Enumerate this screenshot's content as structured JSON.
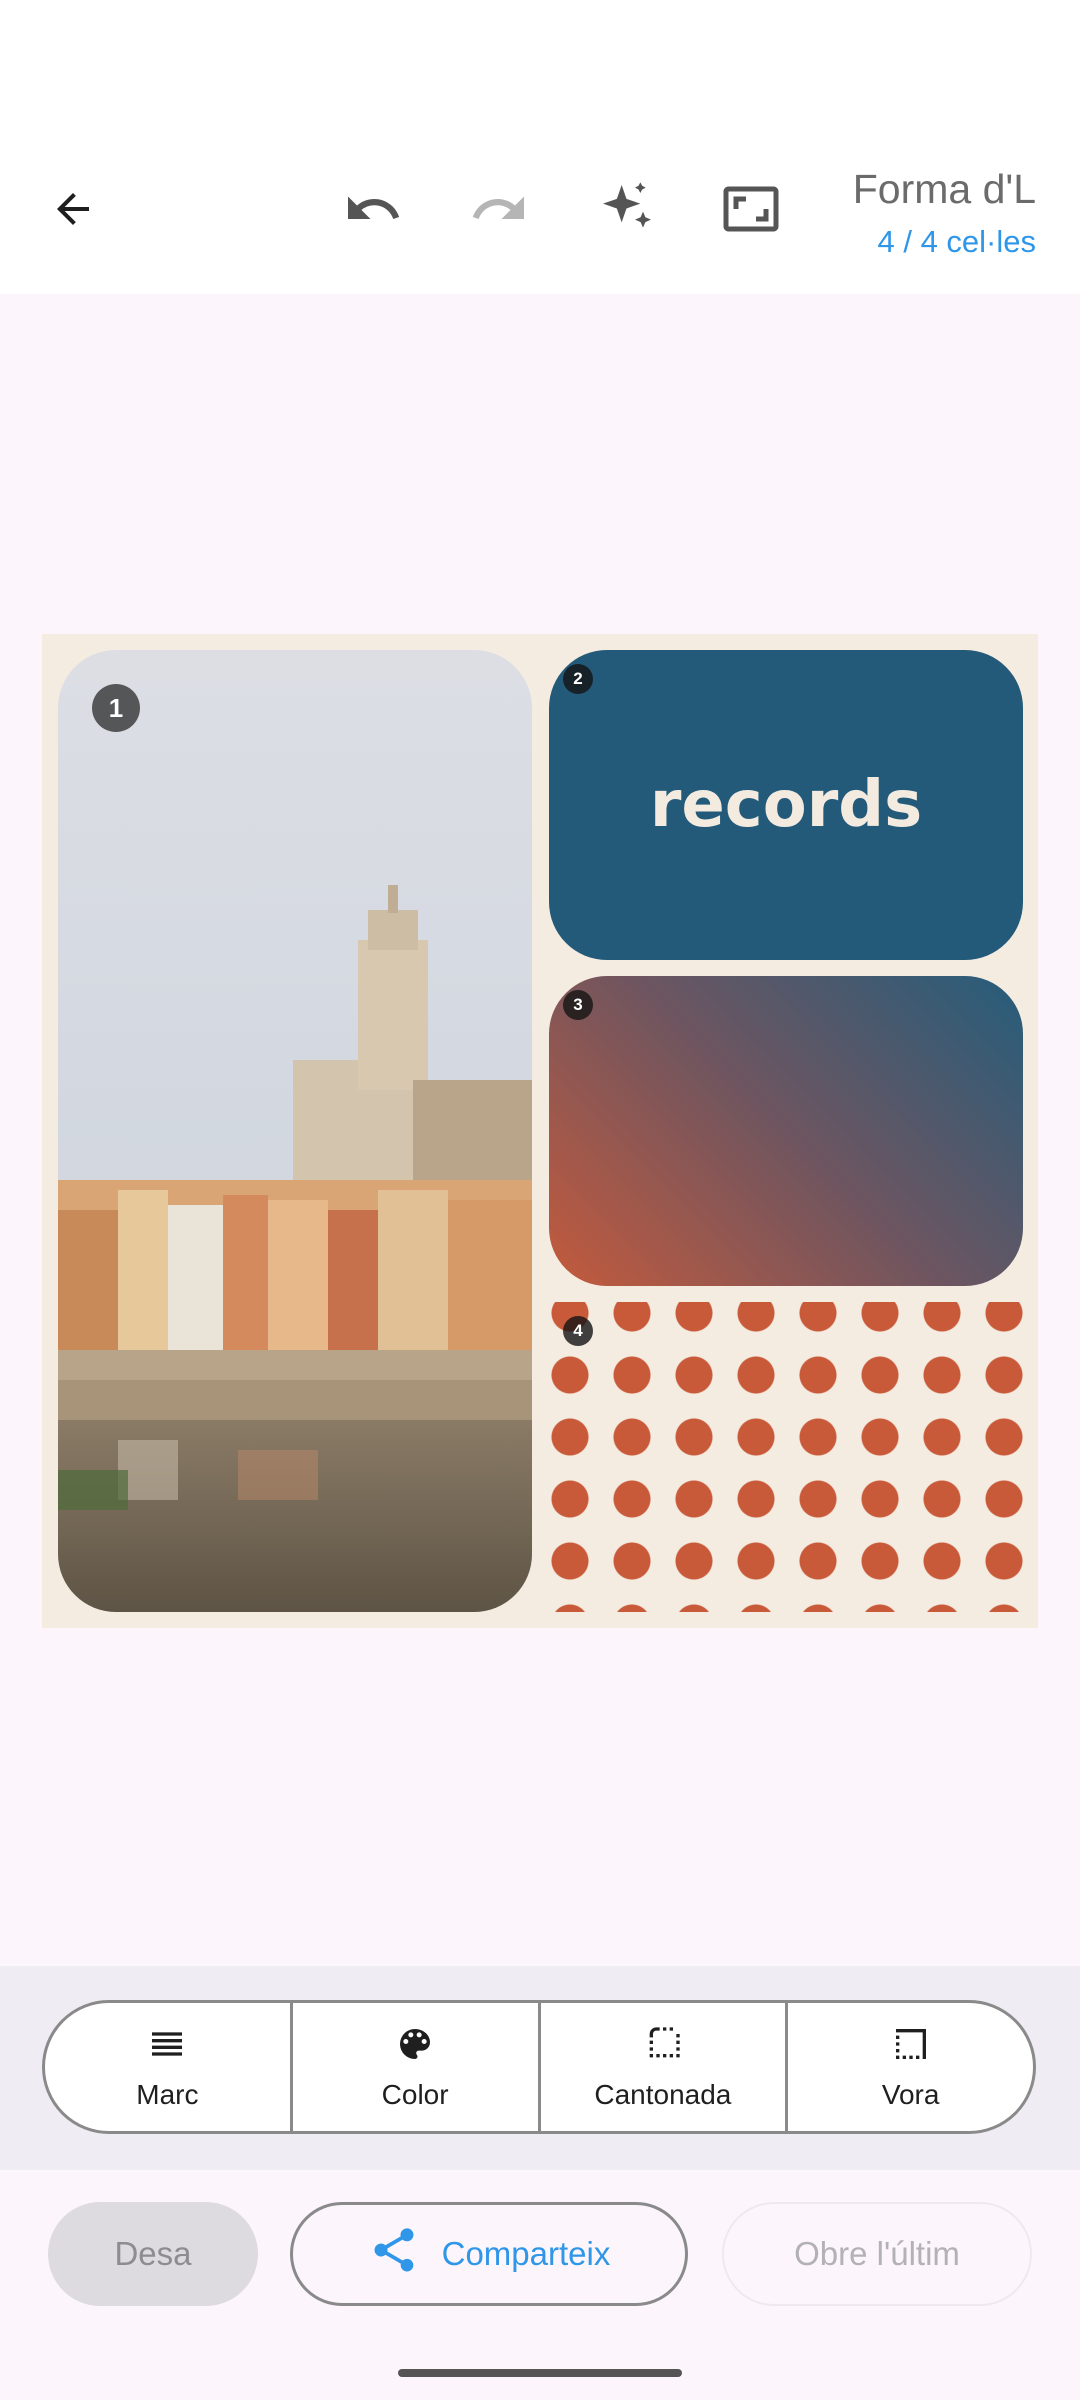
{
  "header": {
    "title": "Forma d'L",
    "subtitle": "4 / 4 cel·les",
    "icons": [
      "back-arrow-icon",
      "undo-icon",
      "redo-icon",
      "sparkle-icon",
      "aspect-ratio-icon"
    ]
  },
  "collage": {
    "cells": [
      {
        "badge": "1",
        "content": "photo"
      },
      {
        "badge": "2",
        "text": "records"
      },
      {
        "badge": "3",
        "content": "gradient"
      },
      {
        "badge": "4",
        "content": "dot-pattern"
      }
    ],
    "colors": {
      "frame": "#f4ece0",
      "text_cell_bg": "#235a7a",
      "text_color": "#f3ebe0",
      "dots": "#c85a3a",
      "gradient_start": "#c45a3c",
      "gradient_end": "#265d7b"
    }
  },
  "toolbar": {
    "items": [
      {
        "label": "Marc",
        "icon": "frame-lines-icon"
      },
      {
        "label": "Color",
        "icon": "palette-icon"
      },
      {
        "label": "Cantonada",
        "icon": "corner-icon"
      },
      {
        "label": "Vora",
        "icon": "border-icon"
      }
    ]
  },
  "actions": {
    "save": "Desa",
    "share": "Comparteix",
    "open_last": "Obre l'últim"
  },
  "accent": "#2f96e8"
}
